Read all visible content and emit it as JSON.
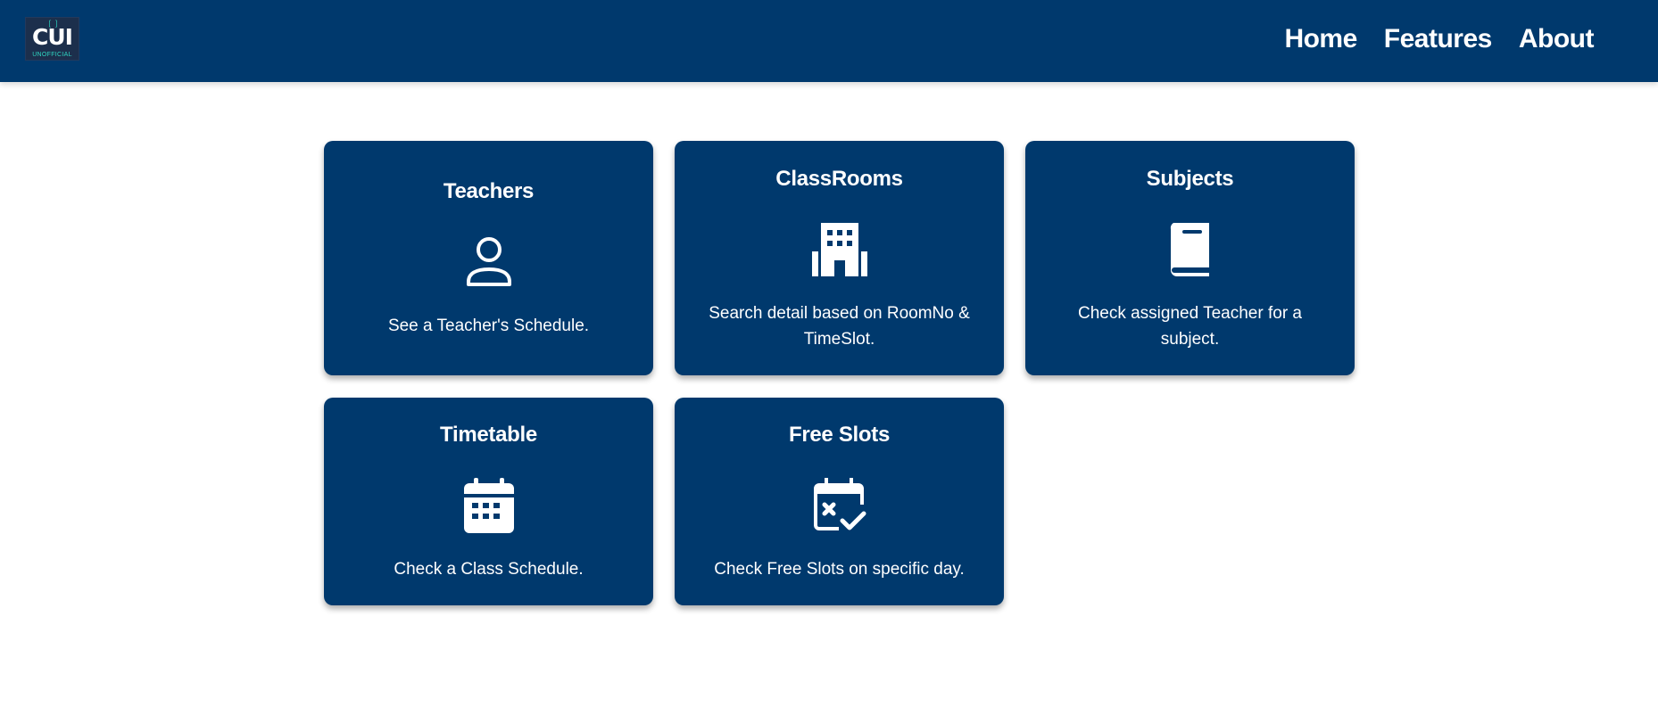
{
  "header": {
    "logo": {
      "text": "CUI",
      "subtext": "UNOFFICIAL"
    },
    "nav": [
      {
        "label": "Home"
      },
      {
        "label": "Features"
      },
      {
        "label": "About"
      }
    ]
  },
  "cards": [
    {
      "title": "Teachers",
      "icon": "person-icon",
      "description": "See a Teacher's Schedule."
    },
    {
      "title": "ClassRooms",
      "icon": "building-icon",
      "description": "Search detail based on RoomNo & TimeSlot."
    },
    {
      "title": "Subjects",
      "icon": "book-icon",
      "description": "Check assigned Teacher for a subject."
    },
    {
      "title": "Timetable",
      "icon": "calendar-icon",
      "description": "Check a Class Schedule."
    },
    {
      "title": "Free Slots",
      "icon": "calendar-check-icon",
      "description": "Check Free Slots on specific day."
    }
  ],
  "colors": {
    "primary": "#00396d",
    "text_on_primary": "#ffffff",
    "background": "#ffffff",
    "logo_accent": "#2fd6c2"
  }
}
